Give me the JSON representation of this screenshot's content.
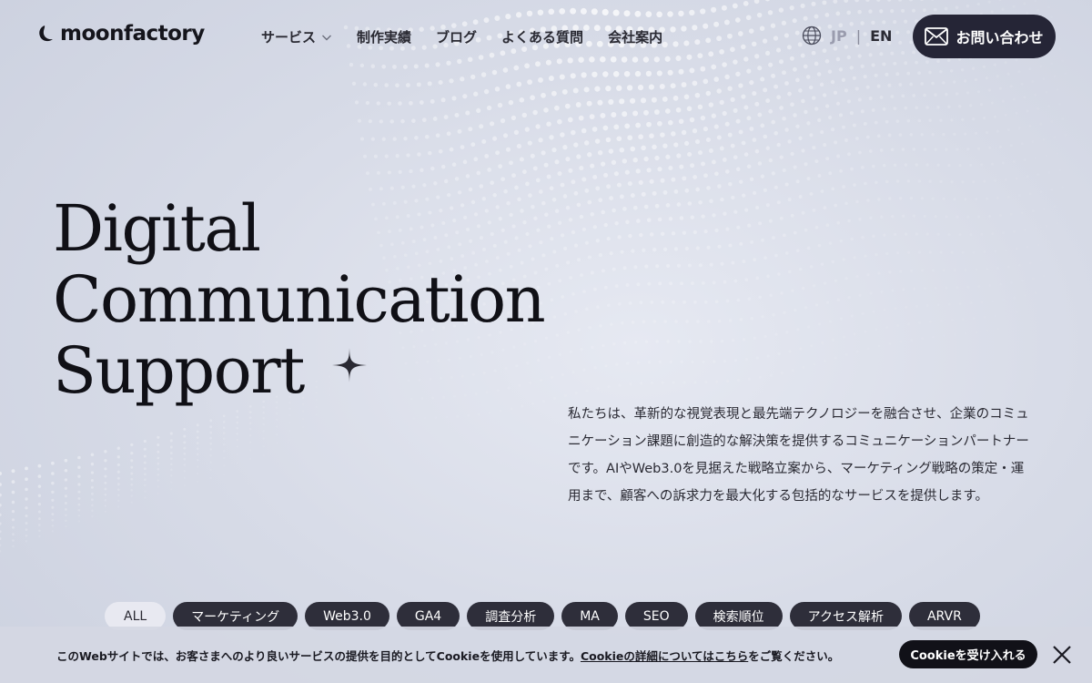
{
  "header": {
    "logo_text": "moonfactory",
    "nav": [
      {
        "label": "サービス",
        "has_dropdown": true
      },
      {
        "label": "制作実績"
      },
      {
        "label": "ブログ"
      },
      {
        "label": "よくある質問"
      },
      {
        "label": "会社案内"
      }
    ],
    "lang": {
      "jp": "JP",
      "separator": "|",
      "en": "EN",
      "active": "EN"
    },
    "contact_label": "お問い合わせ"
  },
  "hero": {
    "title_lines": [
      "Digital",
      "Communication",
      "Support"
    ],
    "description": "私たちは、革新的な視覚表現と最先端テクノロジーを融合させ、企業のコミュニケーション課題に創造的な解決策を提供するコミュニケーションパートナーです。AIやWeb3.0を見据えた戦略立案から、マーケティング戦略の策定・運用まで、顧客への訴求力を最大化する包括的なサービスを提供します。"
  },
  "tags": [
    {
      "label": "ALL",
      "active": true
    },
    {
      "label": "マーケティング"
    },
    {
      "label": "Web3.0"
    },
    {
      "label": "GA4"
    },
    {
      "label": "調査分析"
    },
    {
      "label": "MA"
    },
    {
      "label": "SEO"
    },
    {
      "label": "検索順位"
    },
    {
      "label": "アクセス解析"
    },
    {
      "label": "ARVR"
    }
  ],
  "cookie": {
    "text_before": "このWebサイトでは、お客さまへのより良いサービスの提供を目的としてCookieを使用しています。",
    "link_text": "Cookieの詳細についてはこちら",
    "text_after": "をご覧ください。",
    "accept_label": "Cookieを受け入れる"
  },
  "colors": {
    "dark_button": "#252536",
    "tag_bg": "#2e2e3a",
    "tag_active_bg": "#e8e9f1",
    "lang_inactive": "#9a9cae"
  }
}
